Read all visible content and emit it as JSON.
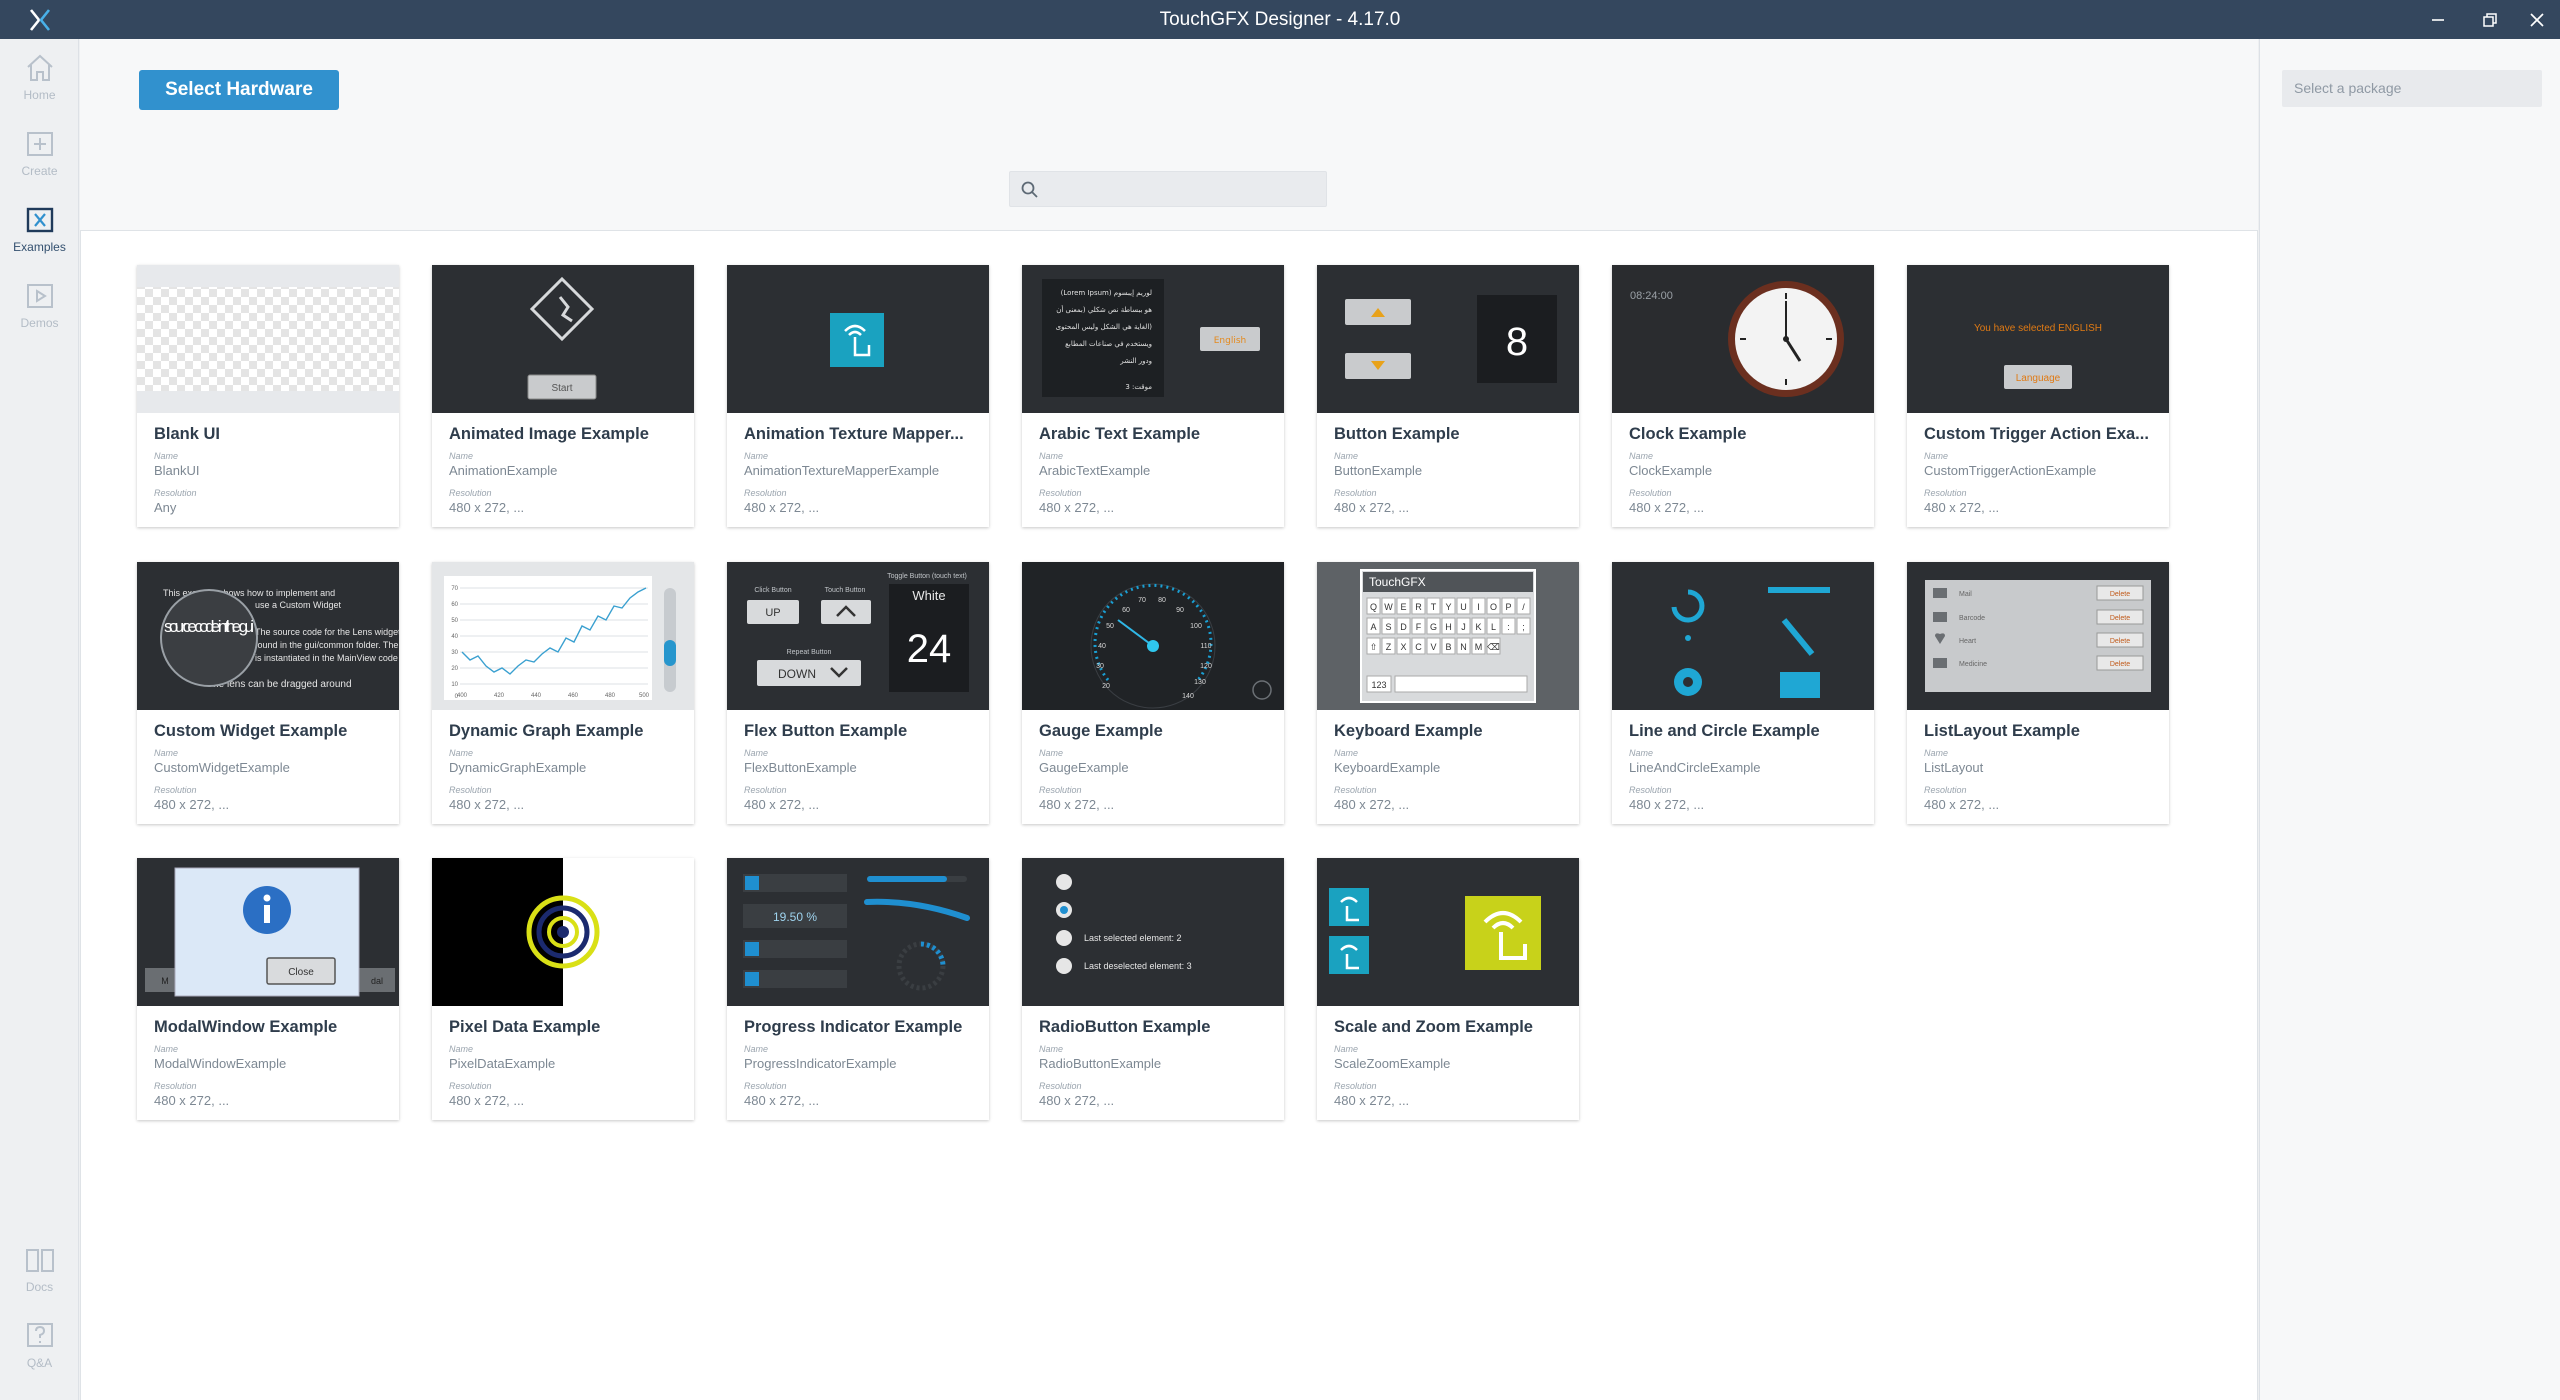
{
  "window": {
    "title": "TouchGFX Designer - 4.17.0"
  },
  "sidebar": {
    "items": [
      {
        "label": "Home"
      },
      {
        "label": "Create"
      },
      {
        "label": "Examples"
      },
      {
        "label": "Demos"
      },
      {
        "label": "Docs"
      },
      {
        "label": "Q&A"
      }
    ],
    "active": "Examples"
  },
  "toolbar": {
    "select_hardware_label": "Select Hardware"
  },
  "search": {
    "placeholder": "",
    "value": ""
  },
  "package_select": {
    "placeholder": "Select a package"
  },
  "labels": {
    "name": "Name",
    "resolution": "Resolution"
  },
  "colors": {
    "titlebar": "#34475e",
    "accent": "#3191ce"
  },
  "cards": [
    {
      "title": "Blank UI",
      "name": "BlankUI",
      "resolution": "Any"
    },
    {
      "title": "Animated Image Example",
      "name": "AnimationExample",
      "resolution": "480 x 272, ..."
    },
    {
      "title": "Animation Texture Mapper...",
      "name": "AnimationTextureMapperExample",
      "resolution": "480 x 272, ..."
    },
    {
      "title": "Arabic Text Example",
      "name": "ArabicTextExample",
      "resolution": "480 x 272, ..."
    },
    {
      "title": "Button Example",
      "name": "ButtonExample",
      "resolution": "480 x 272, ..."
    },
    {
      "title": "Clock Example",
      "name": "ClockExample",
      "resolution": "480 x 272, ..."
    },
    {
      "title": "Custom Trigger Action Exa...",
      "name": "CustomTriggerActionExample",
      "resolution": "480 x 272, ..."
    },
    {
      "title": "Custom Widget Example",
      "name": "CustomWidgetExample",
      "resolution": "480 x 272, ..."
    },
    {
      "title": "Dynamic Graph Example",
      "name": "DynamicGraphExample",
      "resolution": "480 x 272, ..."
    },
    {
      "title": "Flex Button Example",
      "name": "FlexButtonExample",
      "resolution": "480 x 272, ..."
    },
    {
      "title": "Gauge Example",
      "name": "GaugeExample",
      "resolution": "480 x 272, ..."
    },
    {
      "title": "Keyboard Example",
      "name": "KeyboardExample",
      "resolution": "480 x 272, ..."
    },
    {
      "title": "Line and Circle Example",
      "name": "LineAndCircleExample",
      "resolution": "480 x 272, ..."
    },
    {
      "title": "ListLayout Example",
      "name": "ListLayout",
      "resolution": "480 x 272, ..."
    },
    {
      "title": "ModalWindow Example",
      "name": "ModalWindowExample",
      "resolution": "480 x 272, ..."
    },
    {
      "title": "Pixel Data Example",
      "name": "PixelDataExample",
      "resolution": "480 x 272, ..."
    },
    {
      "title": "Progress Indicator Example",
      "name": "ProgressIndicatorExample",
      "resolution": "480 x 272, ..."
    },
    {
      "title": "RadioButton Example",
      "name": "RadioButtonExample",
      "resolution": "480 x 272, ..."
    },
    {
      "title": "Scale and Zoom Example",
      "name": "ScaleZoomExample",
      "resolution": "480 x 272, ..."
    }
  ],
  "thumb_text": {
    "start": "Start",
    "english": "English",
    "arabic_lines": [
      "(Lorem Ipsum) لوريم إيبسوم",
      "هو ببساطة نص شكلي (بمعنى أن",
      "الغاية هي الشكل وليس المحتوى)",
      "ويستخدم في صناعات المطابع",
      "ودور النشر",
      "موقت: 3"
    ],
    "button_number": "8",
    "clock_time": "08:24:00",
    "trigger_selected": "You have selected ENGLISH",
    "trigger_button": "Language",
    "custom_widget_lines": [
      "This example shows how to implement and",
      "use a Custom Widget",
      "The source code for the Lens widget can be",
      "found in the gui/common folder. The widget",
      "is instantiated in the MainView code",
      "The lens can be dragged around"
    ],
    "lens_text": "source code in the gui",
    "graph_y_ticks": [
      "70",
      "60",
      "50",
      "40",
      "30",
      "20",
      "10",
      "0"
    ],
    "graph_x_ticks": [
      "400",
      "420",
      "440",
      "460",
      "480",
      "500"
    ],
    "flex_click_label": "Click Button",
    "flex_touch_label": "Touch Button",
    "flex_toggle_label": "Toggle Button (touch text)",
    "flex_up": "UP",
    "flex_white": "White",
    "flex_number": "24",
    "flex_repeat_label": "Repeat Button",
    "flex_down": "DOWN",
    "gauge_labels": [
      "20",
      "30",
      "40",
      "50",
      "60",
      "70",
      "80",
      "90",
      "100",
      "110",
      "120",
      "130",
      "140"
    ],
    "keyboard_title": "TouchGFX",
    "keyboard_rows": [
      [
        "Q",
        "W",
        "E",
        "R",
        "T",
        "Y",
        "U",
        "I",
        "O",
        "P",
        "/"
      ],
      [
        "A",
        "S",
        "D",
        "F",
        "G",
        "H",
        "J",
        "K",
        "L",
        ":",
        ";"
      ],
      [
        "⇧",
        "Z",
        "X",
        "C",
        "V",
        "B",
        "N",
        "M",
        "⌫"
      ]
    ],
    "keyboard_mode": "123",
    "list_items": [
      "Mail",
      "Barcode",
      "Heart",
      "Medicine"
    ],
    "list_delete": "Delete",
    "modal_close": "Close",
    "modal_behind_left": "M",
    "modal_behind_right": "dal",
    "progress_percent": "19.50 %",
    "radio_last_selected": "Last selected element: 2",
    "radio_last_deselected": "Last deselected element: 3"
  }
}
